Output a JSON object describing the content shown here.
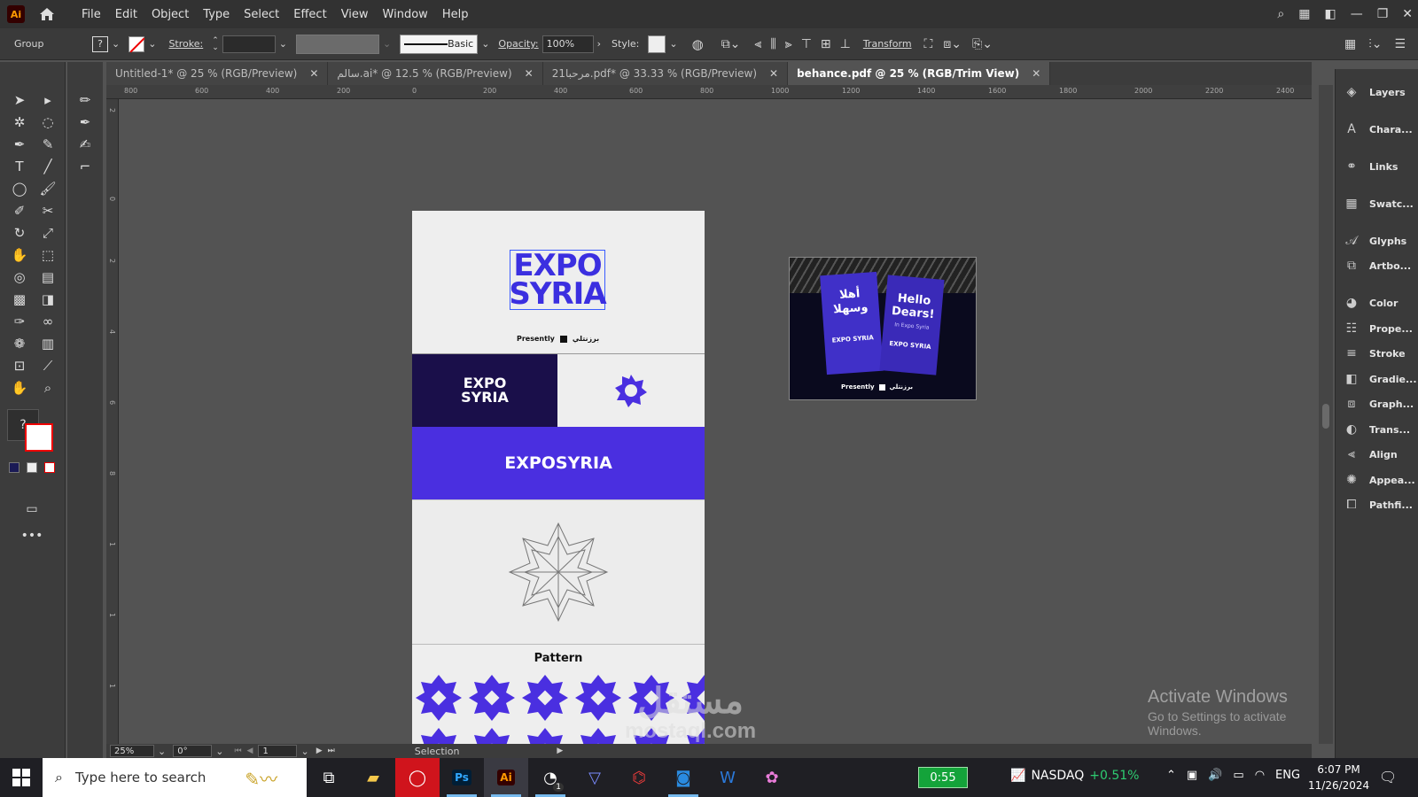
{
  "menubar": {
    "logo": "Ai",
    "items": [
      "File",
      "Edit",
      "Object",
      "Type",
      "Select",
      "Effect",
      "View",
      "Window",
      "Help"
    ]
  },
  "control": {
    "selection": "Group",
    "fill_value": "?",
    "stroke_label": "Stroke:",
    "brush_label": "Basic",
    "opacity_label": "Opacity:",
    "opacity_value": "100%",
    "style_label": "Style:",
    "transform_label": "Transform"
  },
  "tabs": [
    {
      "label": "Untitled-1* @ 25 % (RGB/Preview)",
      "active": false
    },
    {
      "label": "سالم.ai* @ 12.5 % (RGB/Preview)",
      "active": false
    },
    {
      "label": "21مرحبا.pdf* @ 33.33 % (RGB/Preview)",
      "active": false
    },
    {
      "label": "behance.pdf @ 25 % (RGB/Trim View)",
      "active": true
    }
  ],
  "ruler_top": [
    "800",
    "600",
    "400",
    "200",
    "0",
    "200",
    "400",
    "600",
    "800",
    "1000",
    "1200",
    "1400",
    "1600",
    "1800",
    "2000",
    "2200",
    "2400"
  ],
  "ruler_left": [
    "2",
    "0",
    "2",
    "4",
    "6",
    "8",
    "1",
    "1",
    "1"
  ],
  "artboard": {
    "logo_line1": "EXPO",
    "logo_line2": "SYRIA",
    "presented_by": "Presently",
    "arabic_tag": "برزنتلي",
    "banner_text": "EXPOSYRIA",
    "pattern_label": "Pattern"
  },
  "photo": {
    "arabic_banner": "أهلا وسهلا",
    "hello": "Hello Dears!",
    "sub": "In Expo Syria",
    "logo": "EXPO SYRIA"
  },
  "status": {
    "zoom": "25%",
    "rotation": "0°",
    "page": "1",
    "tool": "Selection"
  },
  "panels": [
    "Layers",
    "Chara...",
    "Links",
    "Swatc...",
    "Glyphs",
    "Artbo...",
    "Color",
    "Prope...",
    "Stroke",
    "Gradie...",
    "Graph...",
    "Trans...",
    "Align",
    "Appea...",
    "Pathfi..."
  ],
  "activate": {
    "title": "Activate Windows",
    "sub": "Go to Settings to activate Windows."
  },
  "watermark": {
    "logo": "مستقل",
    "url": "mostaql.com"
  },
  "taskbar": {
    "search_placeholder": "Type here to search",
    "battery": "0:55",
    "stock": "NASDAQ",
    "stock_change": "+0.51%",
    "lang": "ENG",
    "time": "6:07 PM",
    "date": "11/26/2024",
    "badge": "1"
  },
  "colors": {
    "accent": "#4a2fe0",
    "dark_navy": "#1a0f4a",
    "ai_orange": "#ff9a00"
  }
}
